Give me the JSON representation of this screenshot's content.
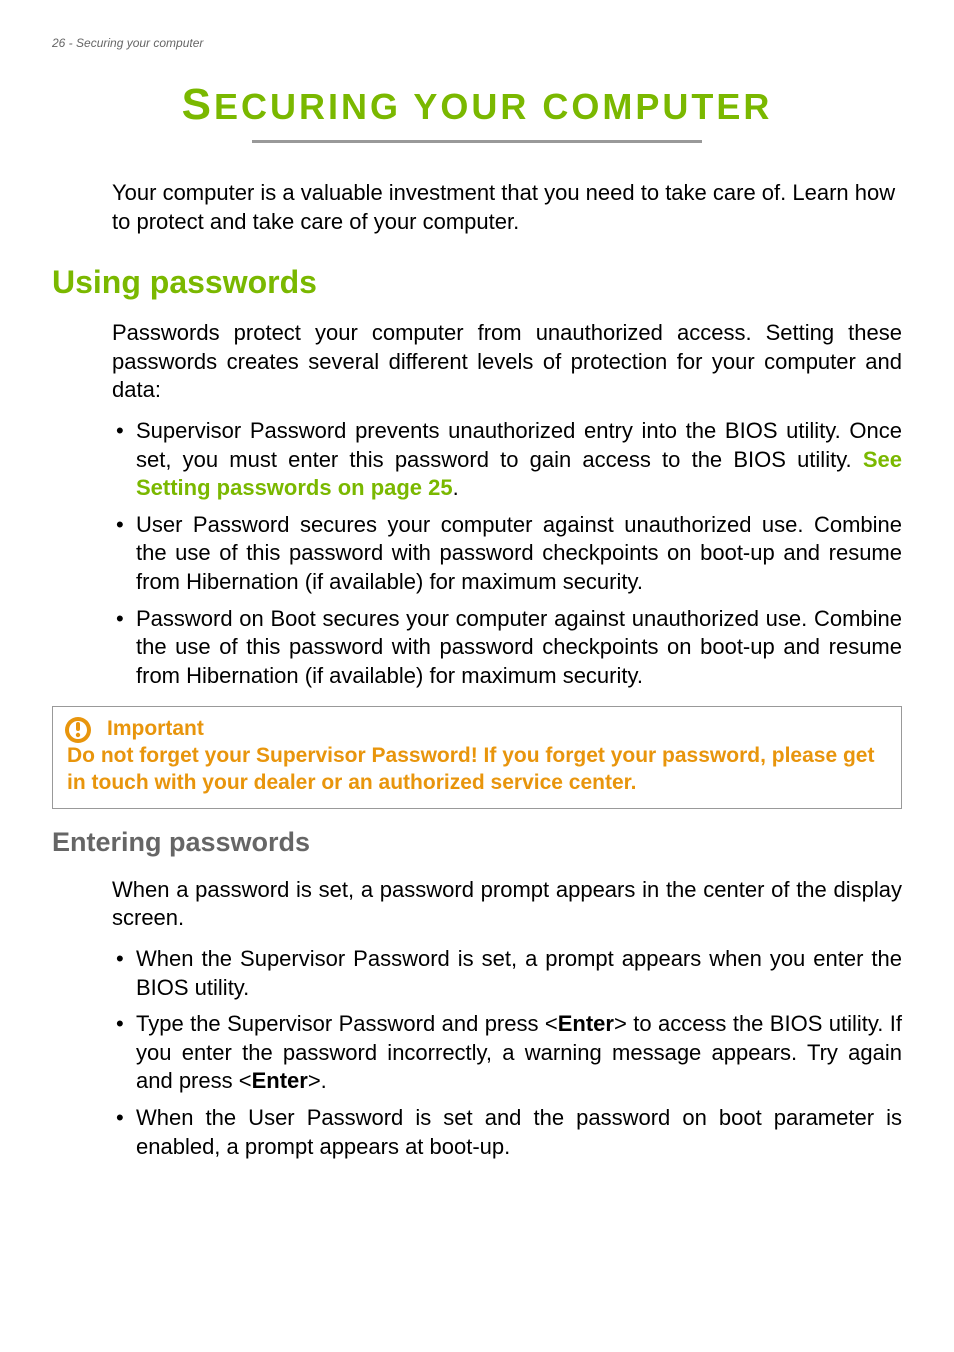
{
  "header": {
    "page_label": "26 - Securing your computer"
  },
  "title": {
    "cap": "S",
    "rest": "ECURING YOUR COMPUTER"
  },
  "intro": "Your computer is a valuable investment that you need to take care of. Learn how to protect and take care of your computer.",
  "section1": {
    "heading": "Using passwords",
    "body": "Passwords protect your computer from unauthorized access. Setting these passwords creates several different levels of protection for your computer and data:",
    "bullets": {
      "b1_pre": "Supervisor Password prevents unauthorized entry into the BIOS utility. Once set, you must enter this password to gain access to the BIOS utility. ",
      "b1_link": "See Setting passwords on page 25",
      "b1_post": ".",
      "b2": "User Password secures your computer against unauthorized use. Combine the use of this password with password checkpoints on boot-up and resume from Hibernation (if available) for maximum security.",
      "b3": "Password on Boot secures your computer against unauthorized use. Combine the use of this password with password checkpoints on boot-up and resume from Hibernation (if available) for maximum security."
    }
  },
  "important": {
    "title": "Important",
    "body": "Do not forget your Supervisor Password! If you forget your password, please get in touch with your dealer or an authorized service center."
  },
  "section2": {
    "heading": "Entering passwords",
    "body": "When a password is set, a password prompt appears in the center of the display screen.",
    "bullets": {
      "b1": "When the Supervisor Password is set, a prompt appears when you enter the BIOS utility.",
      "b2_p1": "Type the Supervisor Password and press <",
      "b2_k1": "Enter",
      "b2_p2": "> to access the BIOS utility. If you enter the password incorrectly, a warning message appears. Try again and press <",
      "b2_k2": "Enter",
      "b2_p3": ">.",
      "b3": "When the User Password is set and the password on boot parameter is enabled, a prompt appears at boot-up."
    }
  }
}
